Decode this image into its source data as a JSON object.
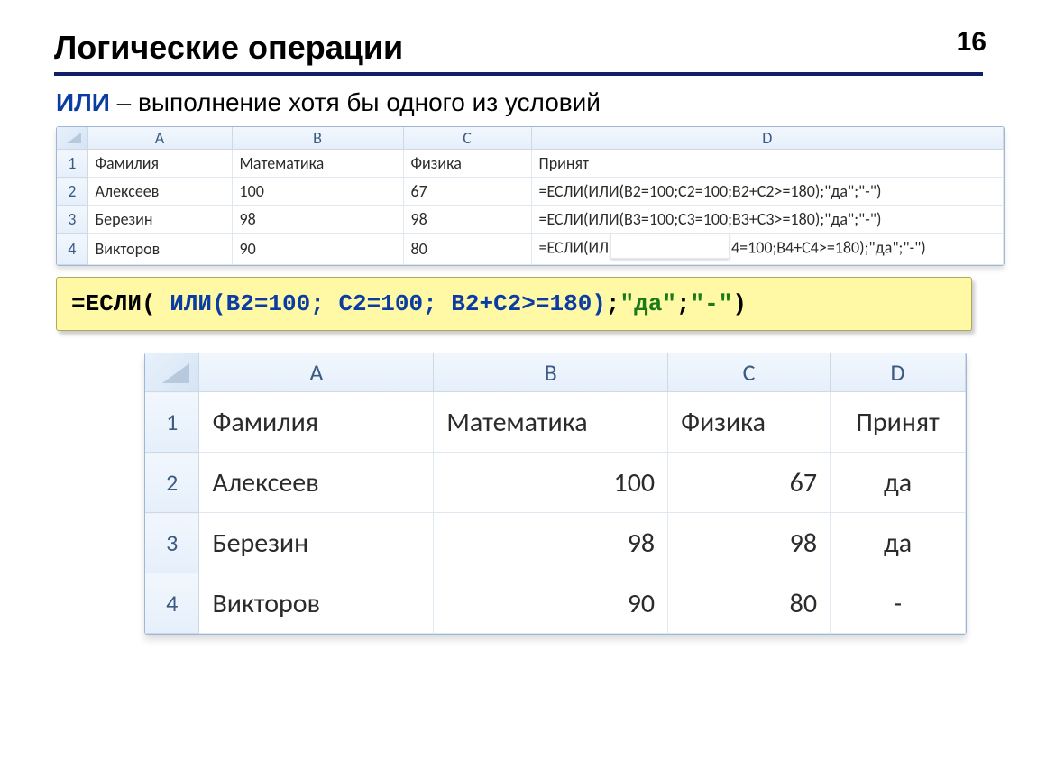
{
  "page_number": "16",
  "title": "Логические операции",
  "subtitle_kw": "ИЛИ",
  "subtitle_rest": " – выполнение хотя бы одного из условий",
  "table1": {
    "columns": [
      "A",
      "B",
      "C",
      "D"
    ],
    "headers": {
      "A": "Фамилия",
      "B": "Математика",
      "C": "Физика",
      "D": "Принят"
    },
    "rows": [
      {
        "n": "1",
        "A": "Фамилия",
        "B": "Математика",
        "C": "Физика",
        "D": "Принят"
      },
      {
        "n": "2",
        "A": "Алексеев",
        "B": "100",
        "C": "67",
        "D": "=ЕСЛИ(ИЛИ(B2=100;C2=100;B2+C2>=180);\"да\";\"-\")"
      },
      {
        "n": "3",
        "A": "Березин",
        "B": "98",
        "C": "98",
        "D": "=ЕСЛИ(ИЛИ(B3=100;C3=100;B3+C3>=180);\"да\";\"-\")"
      },
      {
        "n": "4",
        "A": "Викторов",
        "B": "90",
        "C": "80",
        "D_pre": "=ЕСЛИ(ИЛ",
        "D_post": "4=100;B4+C4>=180);\"да\";\"-\")"
      }
    ]
  },
  "formula": {
    "p1": "=ЕСЛИ( ",
    "p2_blue": "ИЛИ(B2=100; C2=100; B2+C2>=180)",
    "p3": ";",
    "p4_green": "\"да\"",
    "p5": ";",
    "p6_green": "\"-\"",
    "p7": ")"
  },
  "table2": {
    "columns": [
      "A",
      "B",
      "C",
      "D"
    ],
    "rows": [
      {
        "n": "1",
        "A": "Фамилия",
        "B": "Математика",
        "C": "Физика",
        "D": "Принят"
      },
      {
        "n": "2",
        "A": "Алексеев",
        "B": "100",
        "C": "67",
        "D": "да"
      },
      {
        "n": "3",
        "A": "Березин",
        "B": "98",
        "C": "98",
        "D": "да"
      },
      {
        "n": "4",
        "A": "Викторов",
        "B": "90",
        "C": "80",
        "D": "-"
      }
    ]
  }
}
